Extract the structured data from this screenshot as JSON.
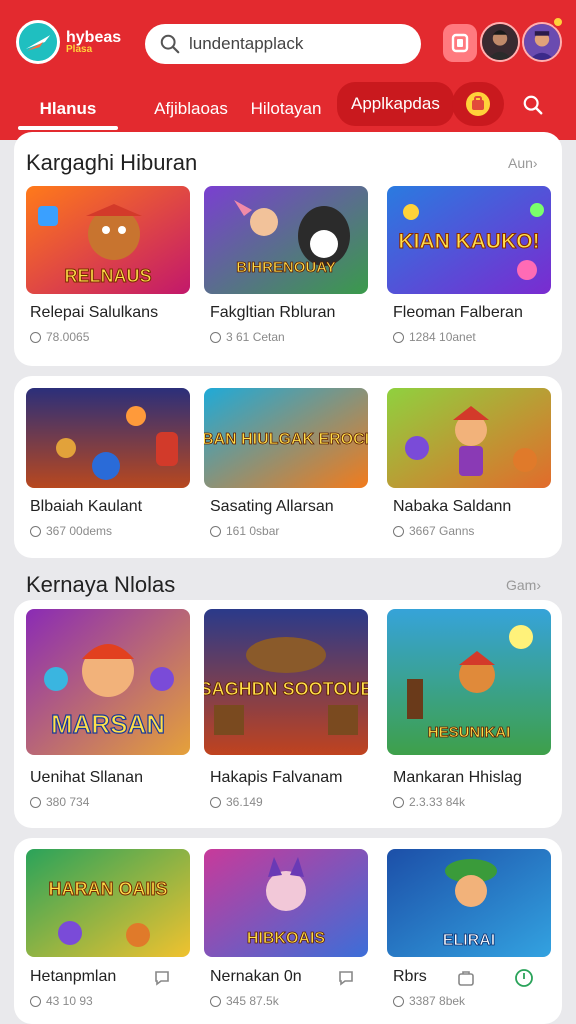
{
  "app": {
    "logo_text": "hybeas",
    "logo_sub": "Plasa"
  },
  "search": {
    "placeholder": "lundentapplack"
  },
  "tabs": [
    {
      "label": "Hlanus",
      "active": true
    },
    {
      "label": "Afjiblaoas"
    },
    {
      "label": "Hilotayan"
    },
    {
      "label": "Applkapdas"
    }
  ],
  "icons": {
    "logo": "leaf-logo-icon",
    "search": "search-icon",
    "square": "square-icon",
    "bag": "bag-icon",
    "comment": "comment-icon"
  },
  "sections": [
    {
      "title": "Kargaghi Hiburan",
      "more": "Aun›",
      "games": [
        {
          "title": "Relepai Salulkans",
          "meta": "78.0065",
          "banner": "RELNAUS",
          "palette": [
            "#ff7a1a",
            "#c2186b"
          ]
        },
        {
          "title": "Fakgltian Rbluran",
          "meta": "3 61 Cetan",
          "banner": "BIHRENOUAY",
          "palette": [
            "#7a3fd1",
            "#3a9b4b"
          ]
        },
        {
          "title": "Fleoman Falberan",
          "meta": "1284 10anet",
          "banner": "KIAN KAUKO!",
          "palette": [
            "#2a7be0",
            "#7a2bd0"
          ]
        }
      ]
    },
    {
      "title": "",
      "more": "",
      "games": [
        {
          "title": "Blbaiah Kaulant",
          "meta": "367 00dems",
          "banner": "",
          "palette": [
            "#2b2f7a",
            "#b8481f"
          ]
        },
        {
          "title": "Sasating Allarsan",
          "meta": "161 0sbar",
          "banner": "SBAN HIULGAK EROCIA",
          "palette": [
            "#1faad8",
            "#f27b1c"
          ]
        },
        {
          "title": "Nabaka Saldann",
          "meta": "3667 Ganns",
          "banner": "",
          "palette": [
            "#8fd13f",
            "#e26b2b"
          ]
        }
      ]
    },
    {
      "title": "Kernaya Nlolas",
      "more": "Gam›",
      "games": [
        {
          "title": "Uenihat Sllanan",
          "meta": "380 734",
          "banner": "MARSAN",
          "palette": [
            "#8a2bb5",
            "#e5a13a"
          ]
        },
        {
          "title": "Hakapis Falvanam",
          "meta": "36.149",
          "banner": "SAGHDN SOOTOUE",
          "palette": [
            "#2a3a8a",
            "#c0431f"
          ]
        },
        {
          "title": "Mankaran Hhislag",
          "meta": "2.3.33 84k",
          "banner": "HESUNIKAI",
          "palette": [
            "#36a3d9",
            "#3ea04a"
          ]
        }
      ]
    },
    {
      "title": "",
      "more": "",
      "games": [
        {
          "title": "Hetanpmlan",
          "meta": "43 10 93",
          "banner": "HARAN OAIIS",
          "palette": [
            "#2aa35a",
            "#f0c22f"
          ]
        },
        {
          "title": "Nernakan 0n",
          "meta": "345 87.5k",
          "banner": "HIBKOAIS",
          "palette": [
            "#c83a9a",
            "#3c6ed8"
          ]
        },
        {
          "title": "Rbrs",
          "meta": "3387 8bek",
          "banner": "ELIRAI",
          "palette": [
            "#1c4fa8",
            "#33a2e0"
          ]
        }
      ]
    }
  ]
}
